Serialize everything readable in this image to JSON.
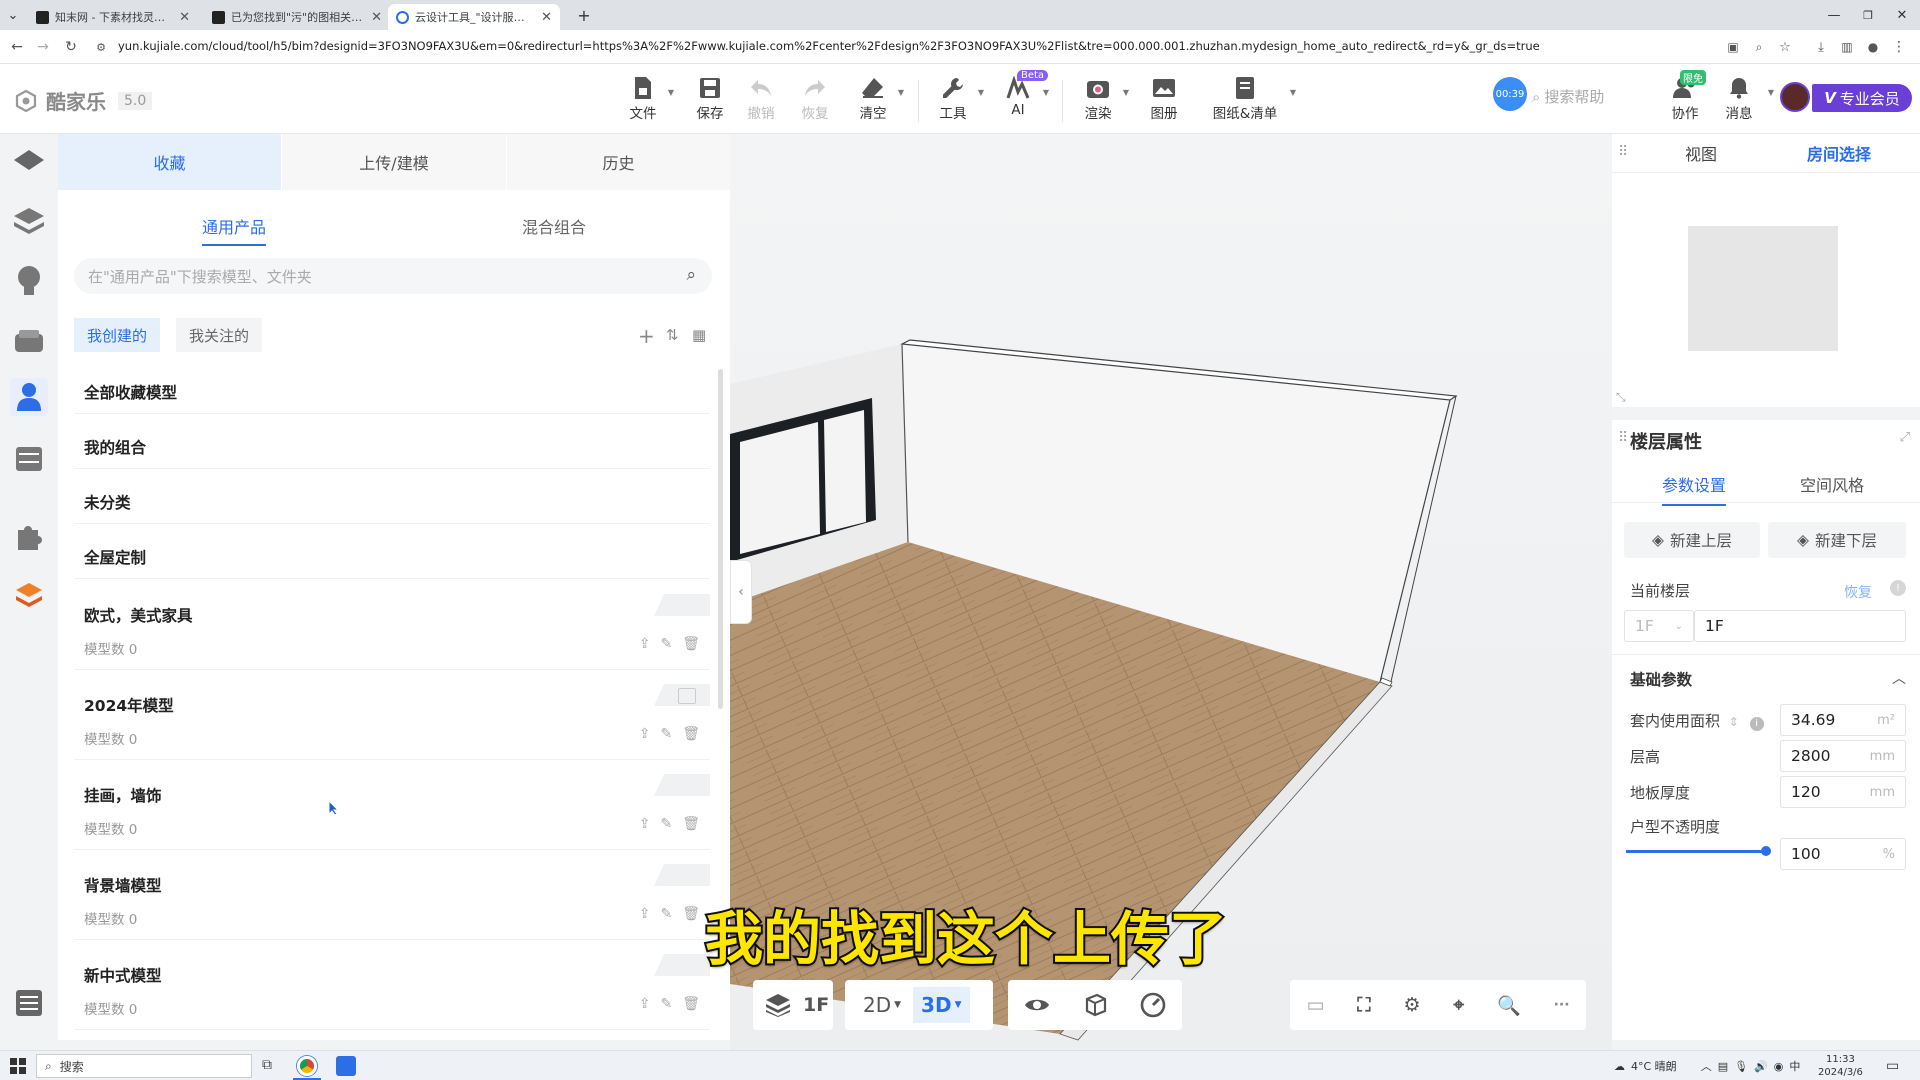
{
  "browser": {
    "tabs": [
      {
        "title": "知末网 - 下素材找灵感看案例",
        "active": false
      },
      {
        "title": "已为您找到\"污\"的图相关素材",
        "active": false
      },
      {
        "title": "云设计工具_\"设计服务王一\"",
        "active": true
      }
    ],
    "new_tab": "+",
    "url": "yun.kujiale.com/cloud/tool/h5/bim?designid=3FO3NO9FAX3U&em=0&redirecturl=https%3A%2F%2Fwww.kujiale.com%2Fcenter%2Fdesign%2F3FO3NO9FAX3U%2Flist&tre=000.000.001.zhuzhan.mydesign_home_auto_redirect&_rd=y&_gr_ds=true"
  },
  "app": {
    "logo": "酷家乐",
    "version": "5.0",
    "toolbar": [
      {
        "label": "文件",
        "icon": "file-icon",
        "caret": true,
        "disabled": false
      },
      {
        "label": "保存",
        "icon": "save-icon",
        "caret": false,
        "disabled": false
      },
      {
        "label": "撤销",
        "icon": "undo-icon",
        "caret": false,
        "disabled": true
      },
      {
        "label": "恢复",
        "icon": "redo-icon",
        "caret": false,
        "disabled": true
      },
      {
        "label": "清空",
        "icon": "eraser-icon",
        "caret": true,
        "disabled": false
      },
      {
        "label": "工具",
        "icon": "wrench-icon",
        "caret": true,
        "disabled": false
      },
      {
        "label": "AI",
        "icon": "ai-icon",
        "caret": true,
        "disabled": false,
        "badge": "Beta"
      },
      {
        "label": "渲染",
        "icon": "camera-icon",
        "caret": true,
        "disabled": false
      },
      {
        "label": "图册",
        "icon": "album-icon",
        "caret": false,
        "disabled": false
      },
      {
        "label": "图纸&清单",
        "icon": "drawing-icon",
        "caret": true,
        "disabled": false
      }
    ],
    "timer": "00:39",
    "help_placeholder": "搜索帮助",
    "collab": {
      "label": "协作",
      "badge": "限免"
    },
    "messages": {
      "label": "消息"
    },
    "vip": "专业会员"
  },
  "left_panel": {
    "tabs": [
      "收藏",
      "上传/建模",
      "历史"
    ],
    "active_tab": "收藏",
    "sub_tabs": [
      "通用产品",
      "混合组合"
    ],
    "active_sub_tab": "通用产品",
    "search_placeholder": "在\"通用产品\"下搜索模型、文件夹",
    "filters": [
      "我创建的",
      "我关注的"
    ],
    "active_filter": "我创建的",
    "simple_items": [
      "全部收藏模型",
      "我的组合",
      "未分类",
      "全屋定制"
    ],
    "folders": [
      {
        "name": "欧式，美式家具",
        "count": "模型数 0"
      },
      {
        "name": "2024年模型",
        "count": "模型数 0"
      },
      {
        "name": "挂画，墙饰",
        "count": "模型数 0"
      },
      {
        "name": "背景墙模型",
        "count": "模型数 0"
      },
      {
        "name": "新中式模型",
        "count": "模型数 0"
      }
    ]
  },
  "viewport": {
    "floor": "1F",
    "view_2d": "2D",
    "view_3d": "3D",
    "active_view": "3D",
    "more": "···",
    "subtitle": "我的找到这个上传了"
  },
  "right_panel": {
    "tabs": [
      "视图",
      "房间选择"
    ],
    "active_tab": "房间选择",
    "section_title": "楼层属性",
    "sub_tabs": [
      "参数设置",
      "空间风格"
    ],
    "active_sub_tab": "参数设置",
    "new_upper": "新建上层",
    "new_lower": "新建下层",
    "current_floor_label": "当前楼层",
    "restore": "恢复",
    "floor_select": "1F",
    "floor_name": "1F",
    "basic_params": "基础参数",
    "params": [
      {
        "label": "套内使用面积",
        "value": "34.69",
        "unit": "m²"
      },
      {
        "label": "层高",
        "value": "2800",
        "unit": "mm"
      },
      {
        "label": "地板厚度",
        "value": "120",
        "unit": "mm"
      }
    ],
    "opacity_label": "户型不透明度",
    "opacity_value": "100",
    "opacity_unit": "%",
    "opacity_fraction": 1.0
  },
  "taskbar": {
    "search_placeholder": "搜索",
    "weather": "4°C 晴朗",
    "ime": "中",
    "time": "11:33",
    "date": "2024/3/6"
  },
  "colors": {
    "accent": "#2b6ee6",
    "subtitle_fill": "#ffe600",
    "vip_bg": "#6a3fd6",
    "floor_wood": "#b59471"
  }
}
